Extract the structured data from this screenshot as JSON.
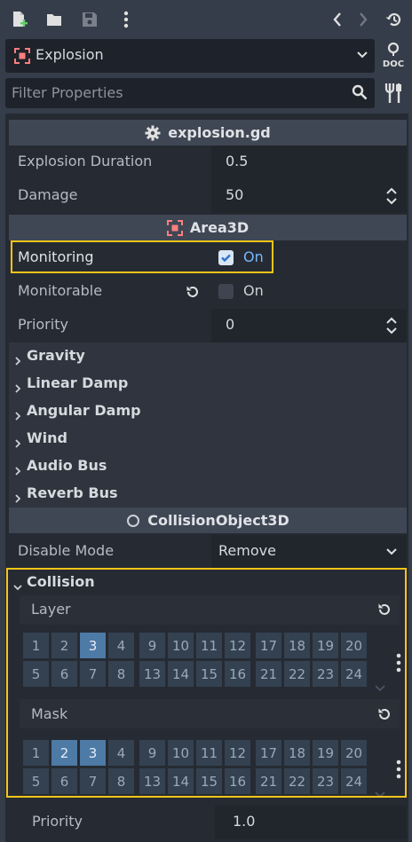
{
  "toolbar": {
    "icons": [
      "new-script-icon",
      "open-folder-icon",
      "save-icon",
      "more-vertical-icon",
      "back-icon",
      "forward-icon",
      "history-icon"
    ]
  },
  "object": {
    "name": "Explosion",
    "icon": "area3d-icon",
    "doc_label": "DOC"
  },
  "filter": {
    "placeholder": "Filter Properties"
  },
  "sections": {
    "script": {
      "title": "explosion.gd"
    },
    "area3d": {
      "title": "Area3D"
    },
    "collision_object": {
      "title": "CollisionObject3D"
    }
  },
  "props": {
    "explosion_duration": {
      "label": "Explosion Duration",
      "value": "0.5"
    },
    "damage": {
      "label": "Damage",
      "value": "50"
    },
    "monitoring": {
      "label": "Monitoring",
      "state": "On",
      "checked": true
    },
    "monitorable": {
      "label": "Monitorable",
      "state": "On",
      "checked": false
    },
    "priority": {
      "label": "Priority",
      "value": "0"
    },
    "disable_mode": {
      "label": "Disable Mode",
      "value": "Remove"
    },
    "collision_priority": {
      "label": "Priority",
      "value": "1.0"
    }
  },
  "groups": [
    "Gravity",
    "Linear Damp",
    "Angular Damp",
    "Wind",
    "Audio Bus",
    "Reverb Bus"
  ],
  "collision": {
    "title": "Collision",
    "layer": {
      "label": "Layer",
      "selected": [
        3
      ]
    },
    "mask": {
      "label": "Mask",
      "selected": [
        2,
        3
      ]
    },
    "grid_rows": [
      [
        "1",
        "2",
        "3",
        "4",
        "9",
        "10",
        "11",
        "12",
        "17",
        "18",
        "19",
        "20"
      ],
      [
        "5",
        "6",
        "7",
        "8",
        "13",
        "14",
        "15",
        "16",
        "21",
        "22",
        "23",
        "24"
      ]
    ]
  },
  "colors": {
    "accent": "#f5c518",
    "selected_layer": "#4e7aa6",
    "area3d_icon": "#fc7f7f"
  }
}
